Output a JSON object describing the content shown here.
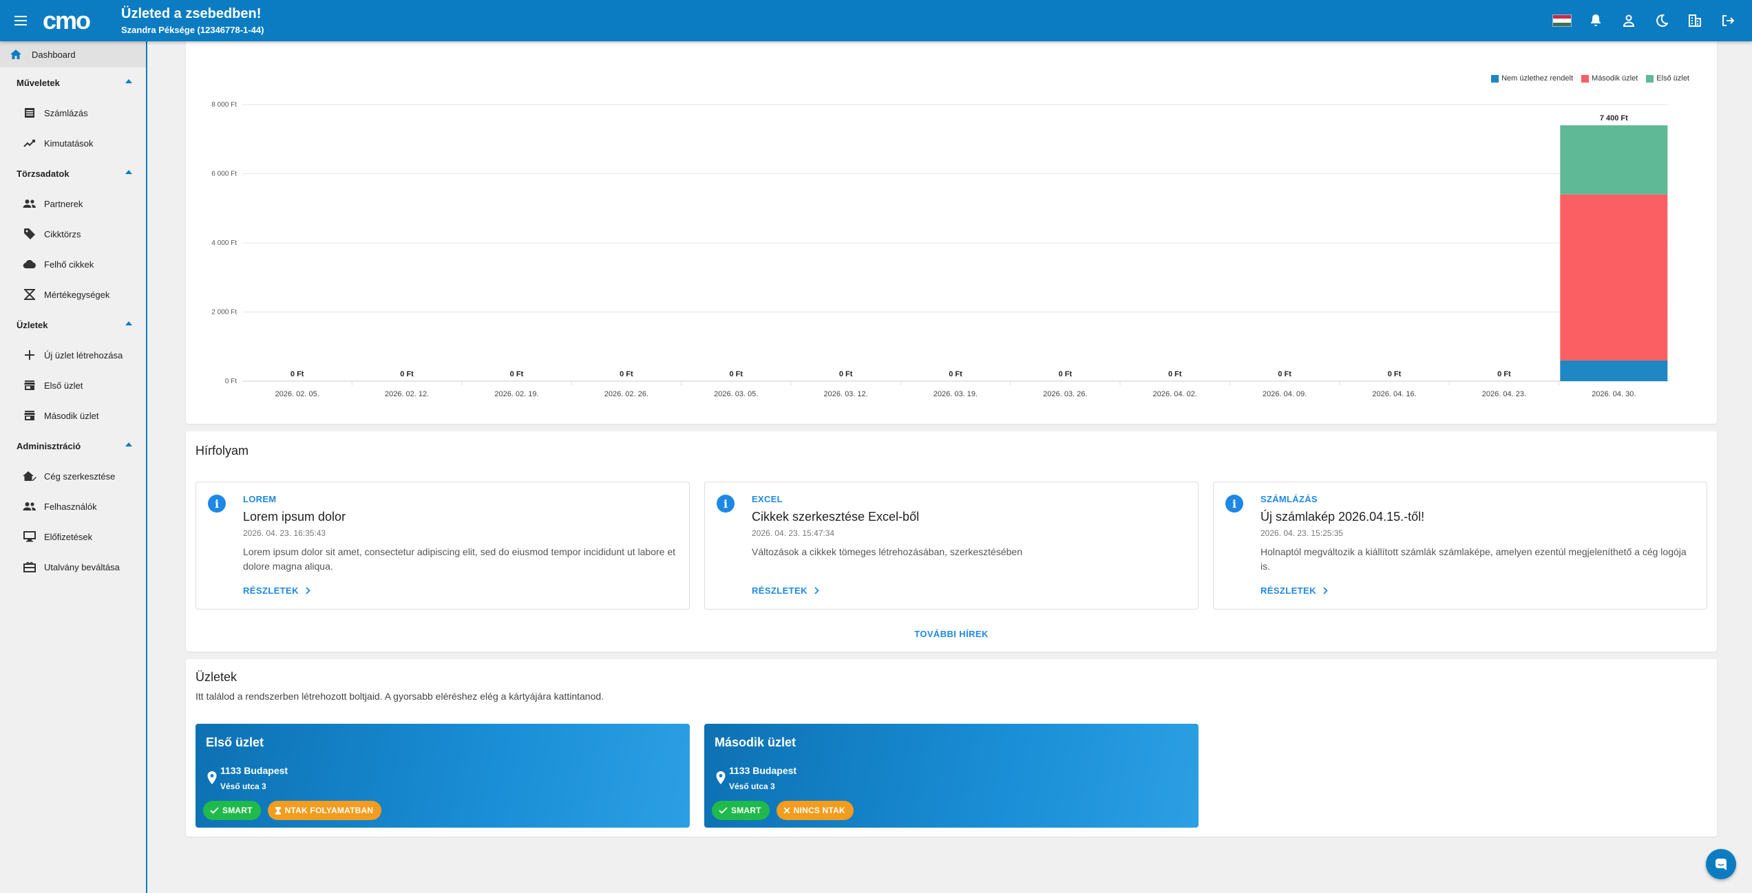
{
  "header": {
    "title": "Üzleted a zsebedben!",
    "subtitle": "Szandra Péksége (12346778-1-44)",
    "logo_text": "cmo",
    "icons": [
      "hungarian-flag",
      "bell-icon",
      "account-icon",
      "moon-icon",
      "company-icon",
      "logout-icon"
    ]
  },
  "sidebar": {
    "dashboard": "Dashboard",
    "sections": [
      {
        "label": "Műveletek",
        "items": [
          {
            "label": "Számlázás",
            "icon": "list-icon"
          },
          {
            "label": "Kimutatások",
            "icon": "trend-icon"
          }
        ]
      },
      {
        "label": "Törzsadatok",
        "items": [
          {
            "label": "Partnerek",
            "icon": "people-icon"
          },
          {
            "label": "Cikktörzs",
            "icon": "tag-icon"
          },
          {
            "label": "Felhő cikkek",
            "icon": "cloud-icon"
          },
          {
            "label": "Mértékegységek",
            "icon": "scale-icon"
          }
        ]
      },
      {
        "label": "Üzletek",
        "items": [
          {
            "label": "Új üzlet létrehozása",
            "icon": "plus-icon"
          },
          {
            "label": "Első üzlet",
            "icon": "store-icon"
          },
          {
            "label": "Második üzlet",
            "icon": "store-icon"
          }
        ]
      },
      {
        "label": "Adminisztráció",
        "items": [
          {
            "label": "Cég szerkesztése",
            "icon": "home-edit-icon"
          },
          {
            "label": "Felhasználók",
            "icon": "people-icon"
          },
          {
            "label": "Előfizetések",
            "icon": "monitor-icon"
          },
          {
            "label": "Utalvány beváltása",
            "icon": "voucher-icon"
          }
        ]
      }
    ]
  },
  "chart_data": {
    "type": "bar",
    "stacked": true,
    "categories": [
      "2026. 02. 05.",
      "2026. 02. 12.",
      "2026. 02. 19.",
      "2026. 02. 26.",
      "2026. 03. 05.",
      "2026. 03. 12.",
      "2026. 03. 19.",
      "2026. 03. 26.",
      "2026. 04. 02.",
      "2026. 04. 09.",
      "2026. 04. 16.",
      "2026. 04. 23.",
      "2026. 04. 30."
    ],
    "series": [
      {
        "name": "Nem üzlethez rendelt",
        "color": "#1f87c4",
        "values": [
          0,
          0,
          0,
          0,
          0,
          0,
          0,
          0,
          0,
          0,
          0,
          0,
          600
        ]
      },
      {
        "name": "Második üzlet",
        "color": "#fb5f63",
        "values": [
          0,
          0,
          0,
          0,
          0,
          0,
          0,
          0,
          0,
          0,
          0,
          0,
          4800
        ]
      },
      {
        "name": "Első üzlet",
        "color": "#5fb996",
        "values": [
          0,
          0,
          0,
          0,
          0,
          0,
          0,
          0,
          0,
          0,
          0,
          0,
          2000
        ]
      }
    ],
    "totals": [
      "0 Ft",
      "0 Ft",
      "0 Ft",
      "0 Ft",
      "0 Ft",
      "0 Ft",
      "0 Ft",
      "0 Ft",
      "0 Ft",
      "0 Ft",
      "0 Ft",
      "0 Ft",
      "7 400 Ft"
    ],
    "yticks": [
      0,
      2000,
      4000,
      6000,
      8000
    ],
    "ytick_labels": [
      "0 Ft",
      "2 000 Ft",
      "4 000 Ft",
      "6 000 Ft",
      "8 000 Ft"
    ],
    "ylim": [
      0,
      8000
    ],
    "grid": true,
    "legend_position": "top-right"
  },
  "news": {
    "title": "Hírfolyam",
    "items": [
      {
        "category": "LOREM",
        "title": "Lorem ipsum dolor",
        "date": "2026. 04. 23. 16:35:43",
        "text": "Lorem ipsum dolor sit amet, consectetur adipiscing elit, sed do eiusmod tempor incididunt ut labore et dolore magna aliqua.",
        "link": "RÉSZLETEK"
      },
      {
        "category": "EXCEL",
        "title": "Cikkek szerkesztése Excel-ből",
        "date": "2026. 04. 23. 15:47:34",
        "text": "Változások a cikkek tömeges létrehozásában, szerkesztésében",
        "link": "RÉSZLETEK"
      },
      {
        "category": "SZÁMLÁZÁS",
        "title": "Új számlakép 2026.04.15.-től!",
        "date": "2026. 04. 23. 15:25:35",
        "text": "Holnaptól megváltozik a kiállított számlák számlaképe, amelyen ezentúl megjeleníthető a cég logója is.",
        "link": "RÉSZLETEK"
      }
    ],
    "more": "TOVÁBBI HÍREK"
  },
  "shops": {
    "title": "Üzletek",
    "description": "Itt találod a rendszerben létrehozott boltjaid. A gyorsabb eléréshez elég a kártyájára kattintanod.",
    "items": [
      {
        "name": "Első üzlet",
        "zip_city": "1133 Budapest",
        "street": "Véső utca 3",
        "badges": [
          {
            "label": "SMART",
            "type": "green",
            "icon": "check-icon"
          },
          {
            "label": "NTAK FOLYAMATBAN",
            "type": "orange",
            "icon": "hourglass-icon"
          }
        ]
      },
      {
        "name": "Második üzlet",
        "zip_city": "1133 Budapest",
        "street": "Véső utca 3",
        "badges": [
          {
            "label": "SMART",
            "type": "green",
            "icon": "check-icon"
          },
          {
            "label": "NINCS NTAK",
            "type": "orange",
            "icon": "close-icon"
          }
        ]
      }
    ]
  },
  "colors": {
    "primary": "#0b7cc2",
    "accent_blue": "#1e88e5",
    "green": "#1fba4b",
    "orange": "#f39c1d"
  }
}
